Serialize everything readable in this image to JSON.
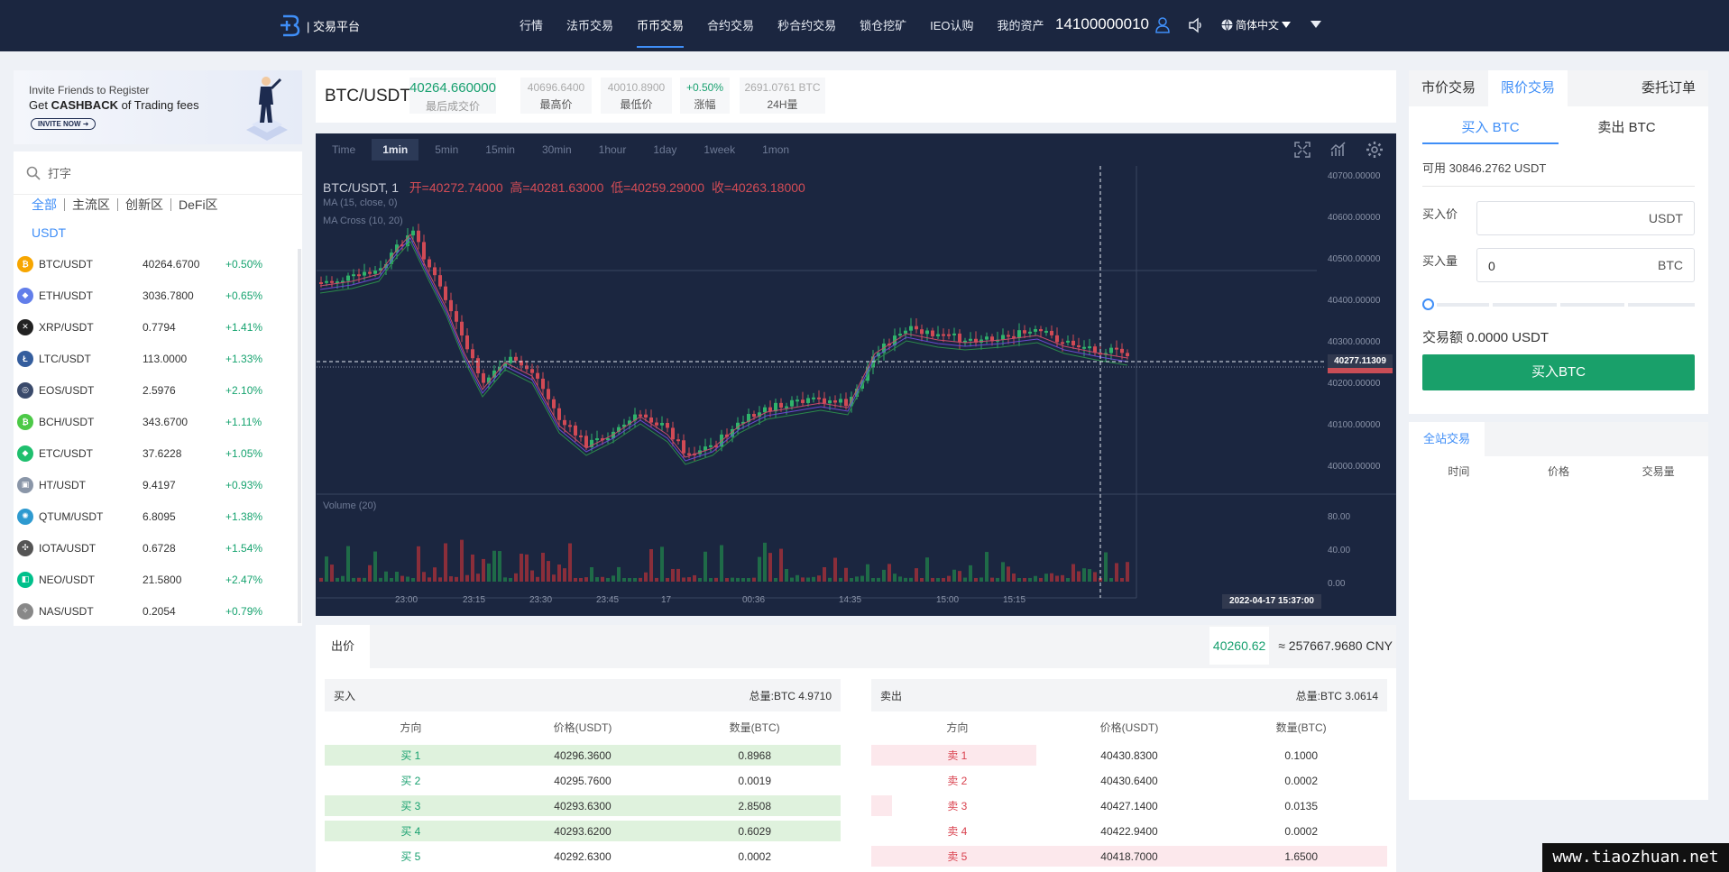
{
  "header": {
    "logo_text": "| 交易平台",
    "nav": [
      "行情",
      "法币交易",
      "币币交易",
      "合约交易",
      "秒合约交易",
      "锁仓挖矿",
      "IEO认购",
      "我的资产"
    ],
    "active_nav": "币币交易",
    "user_phone": "14100000010",
    "language": "简体中文"
  },
  "banner": {
    "line1": "Invite Friends to Register",
    "line2_pre": "Get ",
    "line2_bold": "CASHBACK",
    "line2_post": " of Trading fees",
    "button": "INVITE NOW ➜"
  },
  "market": {
    "search_placeholder": "打字",
    "zones": [
      "全部",
      "主流区",
      "创新区",
      "DeFi区"
    ],
    "quote": "USDT",
    "items": [
      {
        "pair": "BTC/USDT",
        "price": "40264.6700",
        "change": "+0.50%",
        "color": "#f7a600",
        "glyph": "₿"
      },
      {
        "pair": "ETH/USDT",
        "price": "3036.7800",
        "change": "+0.65%",
        "color": "#627eea",
        "glyph": "◆"
      },
      {
        "pair": "XRP/USDT",
        "price": "0.7794",
        "change": "+1.41%",
        "color": "#222222",
        "glyph": "✕"
      },
      {
        "pair": "LTC/USDT",
        "price": "113.0000",
        "change": "+1.33%",
        "color": "#345d9d",
        "glyph": "Ł"
      },
      {
        "pair": "EOS/USDT",
        "price": "2.5976",
        "change": "+2.10%",
        "color": "#3a4a6b",
        "glyph": "◎"
      },
      {
        "pair": "BCH/USDT",
        "price": "343.6700",
        "change": "+1.11%",
        "color": "#4cc947",
        "glyph": "₿"
      },
      {
        "pair": "ETC/USDT",
        "price": "37.6228",
        "change": "+1.05%",
        "color": "#1fbf6e",
        "glyph": "◆"
      },
      {
        "pair": "HT/USDT",
        "price": "9.4197",
        "change": "+0.93%",
        "color": "#8a96a8",
        "glyph": "▣"
      },
      {
        "pair": "QTUM/USDT",
        "price": "6.8095",
        "change": "+1.38%",
        "color": "#2e9ad0",
        "glyph": "✺"
      },
      {
        "pair": "IOTA/USDT",
        "price": "0.6728",
        "change": "+1.54%",
        "color": "#555555",
        "glyph": "✣"
      },
      {
        "pair": "NEO/USDT",
        "price": "21.5800",
        "change": "+2.47%",
        "color": "#00c08b",
        "glyph": "◧"
      },
      {
        "pair": "NAS/USDT",
        "price": "0.2054",
        "change": "+0.79%",
        "color": "#888888",
        "glyph": "✧"
      }
    ]
  },
  "ticker": {
    "symbol": "BTC/USDT",
    "last": "40264.660000",
    "last_label": "最后成交价",
    "high": "40696.6400",
    "high_label": "最高价",
    "low": "40010.8900",
    "low_label": "最低价",
    "change": "+0.50%",
    "change_label": "涨幅",
    "volume": "2691.0761 BTC",
    "volume_label": "24H量"
  },
  "chart": {
    "timeframes": [
      "Time",
      "1min",
      "5min",
      "15min",
      "30min",
      "1hour",
      "1day",
      "1week",
      "1mon"
    ],
    "active_timeframe": "1min",
    "legend_symbol": "BTC/USDT, 1",
    "o_label": "开=",
    "o": "40272.74000",
    "h_label": "高=",
    "h": "40281.63000",
    "l_label": "低=",
    "l": "40259.29000",
    "c_label": "收=",
    "c": "40263.18000",
    "ma_label": "MA (15, close, 0)",
    "macross_label": "MA Cross (10, 20)",
    "volume_label": "Volume (20)",
    "price_tag": "40277.11309",
    "time_tag": "2022-04-17 15:37:00",
    "y_ticks": [
      "40700.00000",
      "40600.00000",
      "40500.00000",
      "40400.00000",
      "40300.00000",
      "40200.00000",
      "40100.00000",
      "40000.00000"
    ],
    "vol_ticks": [
      "80.00",
      "40.00",
      "0.00"
    ],
    "x_ticks": [
      "23:00",
      "23:15",
      "23:30",
      "23:45",
      "17",
      "00:36",
      "14:35",
      "15:00",
      "15:15"
    ]
  },
  "orderbook": {
    "tab": "出价",
    "last_price": "40260.62",
    "cny": "≈ 257667.9680 CNY",
    "buy": {
      "title": "买入",
      "total": "总量:BTC 4.9710",
      "cols": [
        "方向",
        "价格(USDT)",
        "数量(BTC)"
      ],
      "rows": [
        {
          "dir": "买 1",
          "price": "40296.3600",
          "qty": "0.8968",
          "depth": 1.0
        },
        {
          "dir": "买 2",
          "price": "40295.7600",
          "qty": "0.0019",
          "depth": 0.0
        },
        {
          "dir": "买 3",
          "price": "40293.6300",
          "qty": "2.8508",
          "depth": 1.0
        },
        {
          "dir": "买 4",
          "price": "40293.6200",
          "qty": "0.6029",
          "depth": 1.0
        },
        {
          "dir": "买 5",
          "price": "40292.6300",
          "qty": "0.0002",
          "depth": 0.0
        }
      ]
    },
    "sell": {
      "title": "卖出",
      "total": "总量:BTC 3.0614",
      "cols": [
        "方向",
        "价格(USDT)",
        "数量(BTC)"
      ],
      "rows": [
        {
          "dir": "卖 1",
          "price": "40430.8300",
          "qty": "0.1000",
          "depth": 0.32
        },
        {
          "dir": "卖 2",
          "price": "40430.6400",
          "qty": "0.0002",
          "depth": 0.0
        },
        {
          "dir": "卖 3",
          "price": "40427.1400",
          "qty": "0.0135",
          "depth": 0.04
        },
        {
          "dir": "卖 4",
          "price": "40422.9400",
          "qty": "0.0002",
          "depth": 0.0
        },
        {
          "dir": "卖 5",
          "price": "40418.7000",
          "qty": "1.6500",
          "depth": 1.0
        }
      ]
    }
  },
  "trade_panel": {
    "tabs": [
      "市价交易",
      "限价交易",
      "委托订单"
    ],
    "active_tab": "限价交易",
    "buy_tab": "买入 BTC",
    "sell_tab": "卖出 BTC",
    "available": "可用 30846.2762 USDT",
    "price_label": "买入价",
    "price_value": "",
    "price_unit": "USDT",
    "amount_label": "买入量",
    "amount_value": "0",
    "amount_unit": "BTC",
    "slider_percent": 0,
    "total": "交易额 0.0000 USDT",
    "button": "买入BTC"
  },
  "trades": {
    "tab": "全站交易",
    "cols": [
      "时间",
      "价格",
      "交易量"
    ]
  },
  "watermark": "www.tiaozhuan.net"
}
